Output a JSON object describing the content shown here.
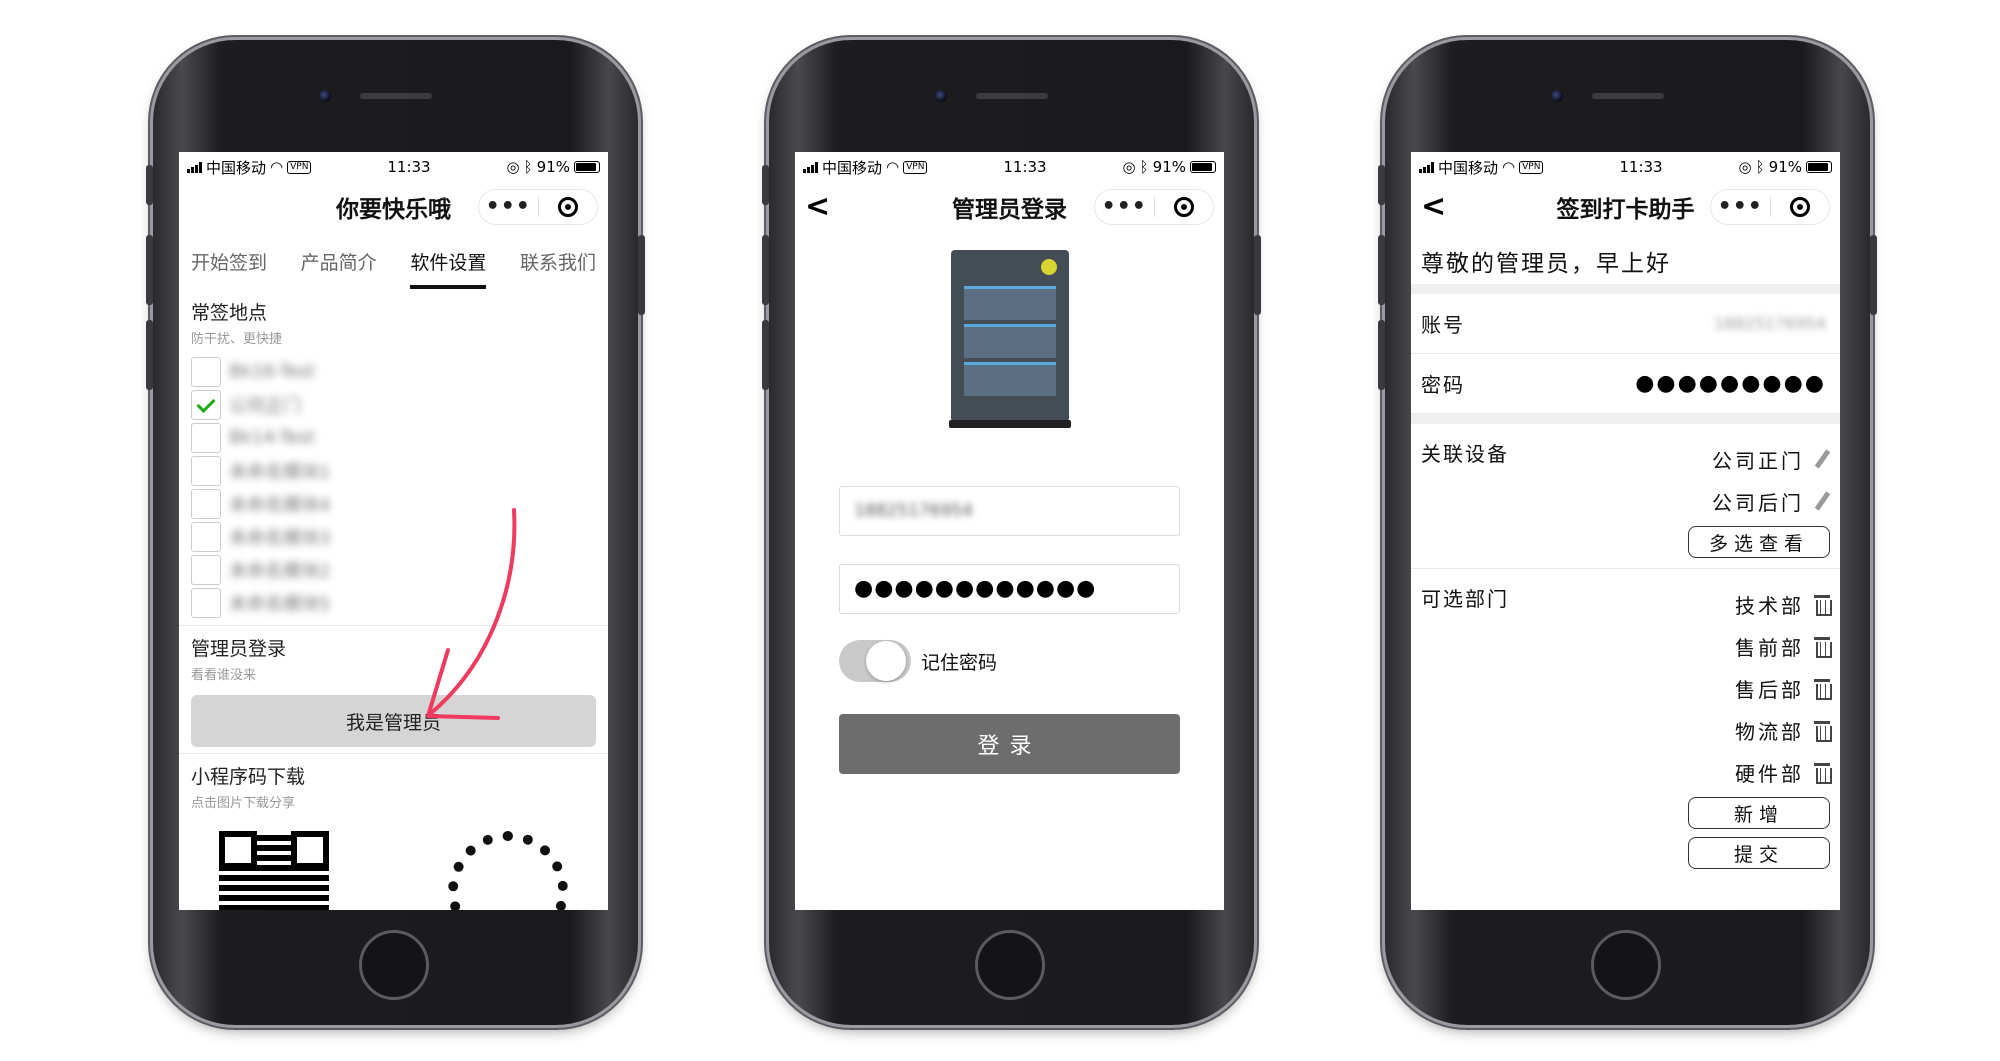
{
  "status": {
    "carrier": "中国移动",
    "vpn": "VPN",
    "time": "11:33",
    "battery": "91%"
  },
  "screen1": {
    "title": "你要快乐哦",
    "tabs": [
      "开始签到",
      "产品简介",
      "软件设置",
      "联系我们"
    ],
    "locations": {
      "title": "常签地点",
      "subtitle": "防干扰、更快捷",
      "items": [
        {
          "label": "Bk16-Test",
          "checked": false
        },
        {
          "label": "公司正门",
          "checked": true
        },
        {
          "label": "Bk14-Test",
          "checked": false
        },
        {
          "label": "未命名模块1",
          "checked": false
        },
        {
          "label": "未命名模块4",
          "checked": false
        },
        {
          "label": "未命名模块3",
          "checked": false
        },
        {
          "label": "未命名模块2",
          "checked": false
        },
        {
          "label": "未命名模块5",
          "checked": false
        }
      ]
    },
    "admin": {
      "title": "管理员登录",
      "subtitle": "看看谁没来",
      "button": "我是管理员"
    },
    "download": {
      "title": "小程序码下载",
      "subtitle": "点击图片下载分享"
    },
    "arrow_color": "#f03a5f"
  },
  "screen2": {
    "title": "管理员登录",
    "username_value": "18825176954",
    "password_mask": "●●●●●●●●●●●●",
    "remember_label": "记住密码",
    "remember_on": false,
    "login_button": "登录"
  },
  "screen3": {
    "title": "签到打卡助手",
    "greeting": "尊敬的管理员，早上好",
    "account_label": "账号",
    "account_value": "18825176954",
    "password_label": "密码",
    "password_mask": "●●●●●●●●●",
    "devices_label": "关联设备",
    "devices": [
      "公司正门",
      "公司后门"
    ],
    "devices_button": "多选查看",
    "depts_label": "可选部门",
    "depts": [
      "技术部",
      "售前部",
      "售后部",
      "物流部",
      "硬件部"
    ],
    "add_button": "新增",
    "submit_button": "提交"
  }
}
